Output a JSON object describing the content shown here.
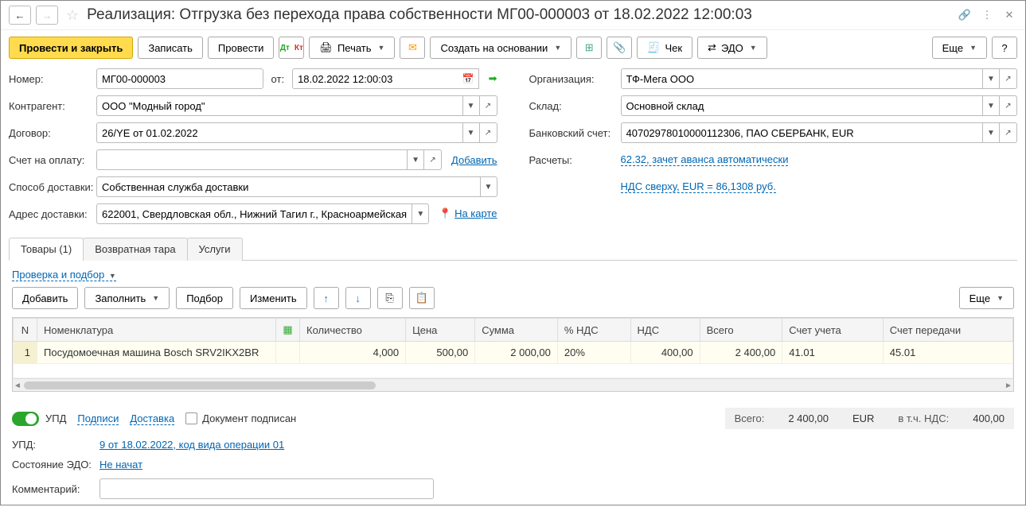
{
  "title": "Реализация: Отгрузка без перехода права собственности МГ00-000003 от 18.02.2022 12:00:03",
  "toolbar": {
    "post_close": "Провести и закрыть",
    "write": "Записать",
    "post": "Провести",
    "print": "Печать",
    "create_based": "Создать на основании",
    "receipt": "Чек",
    "edo": "ЭДО",
    "more": "Еще"
  },
  "form": {
    "number_label": "Номер:",
    "number": "МГ00-000003",
    "from_label": "от:",
    "date": "18.02.2022 12:00:03",
    "contragent_label": "Контрагент:",
    "contragent": "ООО \"Модный город\"",
    "contract_label": "Договор:",
    "contract": "26/YE от 01.02.2022",
    "invoice_label": "Счет на оплату:",
    "invoice": "",
    "add_link": "Добавить",
    "delivery_method_label": "Способ доставки:",
    "delivery_method": "Собственная служба доставки",
    "delivery_addr_label": "Адрес доставки:",
    "delivery_addr": "622001, Свердловская обл., Нижний Тагил г., Красноармейская",
    "on_map": "На карте",
    "org_label": "Организация:",
    "org": "ТФ-Мега ООО",
    "warehouse_label": "Склад:",
    "warehouse": "Основной склад",
    "bank_label": "Банковский счет:",
    "bank": "40702978010000112306, ПАО СБЕРБАНК, EUR",
    "settlements_label": "Расчеты:",
    "settlements_link": "62.32, зачет аванса автоматически",
    "vat_link": "НДС сверху, EUR = 86,1308 руб."
  },
  "tabs": {
    "goods": "Товары (1)",
    "returnable": "Возвратная тара",
    "services": "Услуги"
  },
  "tab_content": {
    "check_pick": "Проверка и подбор",
    "add": "Добавить",
    "fill": "Заполнить",
    "pick": "Подбор",
    "change": "Изменить",
    "more": "Еще"
  },
  "table": {
    "headers": {
      "n": "N",
      "item": "Номенклатура",
      "icon": "",
      "qty": "Количество",
      "price": "Цена",
      "sum": "Сумма",
      "vat_pct": "% НДС",
      "vat": "НДС",
      "total": "Всего",
      "account": "Счет учета",
      "transfer_account": "Счет передачи"
    },
    "rows": [
      {
        "n": "1",
        "item": "Посудомоечная машина Bosch SRV2IKX2BR",
        "qty": "4,000",
        "price": "500,00",
        "sum": "2 000,00",
        "vat_pct": "20%",
        "vat": "400,00",
        "total": "2 400,00",
        "account": "41.01",
        "transfer_account": "45.01"
      }
    ]
  },
  "bottom": {
    "upd": "УПД",
    "signatures": "Подписи",
    "delivery": "Доставка",
    "doc_signed": "Документ подписан",
    "totals_label": "Всего:",
    "totals_value": "2 400,00",
    "currency": "EUR",
    "vat_label": "в т.ч. НДС:",
    "vat_value": "400,00",
    "upd_label": "УПД:",
    "upd_link": "9 от 18.02.2022, код вида операции 01",
    "edo_status_label": "Состояние ЭДО:",
    "edo_status": "Не начат",
    "comment_label": "Комментарий:",
    "comment": ""
  }
}
